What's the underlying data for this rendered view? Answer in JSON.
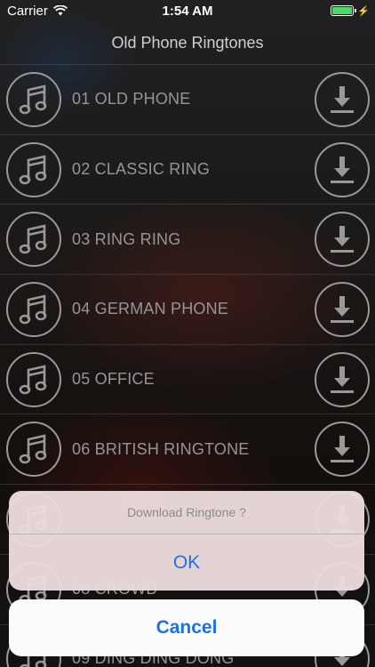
{
  "status_bar": {
    "carrier": "Carrier",
    "time": "1:54 AM"
  },
  "nav": {
    "title": "Old Phone Ringtones"
  },
  "ringtones": [
    {
      "label": "01 OLD PHONE"
    },
    {
      "label": "02 CLASSIC RING"
    },
    {
      "label": "03 RING RING"
    },
    {
      "label": "04 GERMAN PHONE"
    },
    {
      "label": "05 OFFICE"
    },
    {
      "label": "06 BRITISH RINGTONE"
    },
    {
      "label": ""
    },
    {
      "label": "08 CROWD"
    },
    {
      "label": "09 DING DING DONG"
    }
  ],
  "alert": {
    "title": "Download Ringtone ?",
    "ok_label": "OK"
  },
  "cancel": {
    "label": "Cancel"
  },
  "colors": {
    "accent": "#1a73e8",
    "battery": "#4cd964"
  },
  "icons": {
    "row_left": "music-note-icon",
    "row_right": "download-icon"
  }
}
